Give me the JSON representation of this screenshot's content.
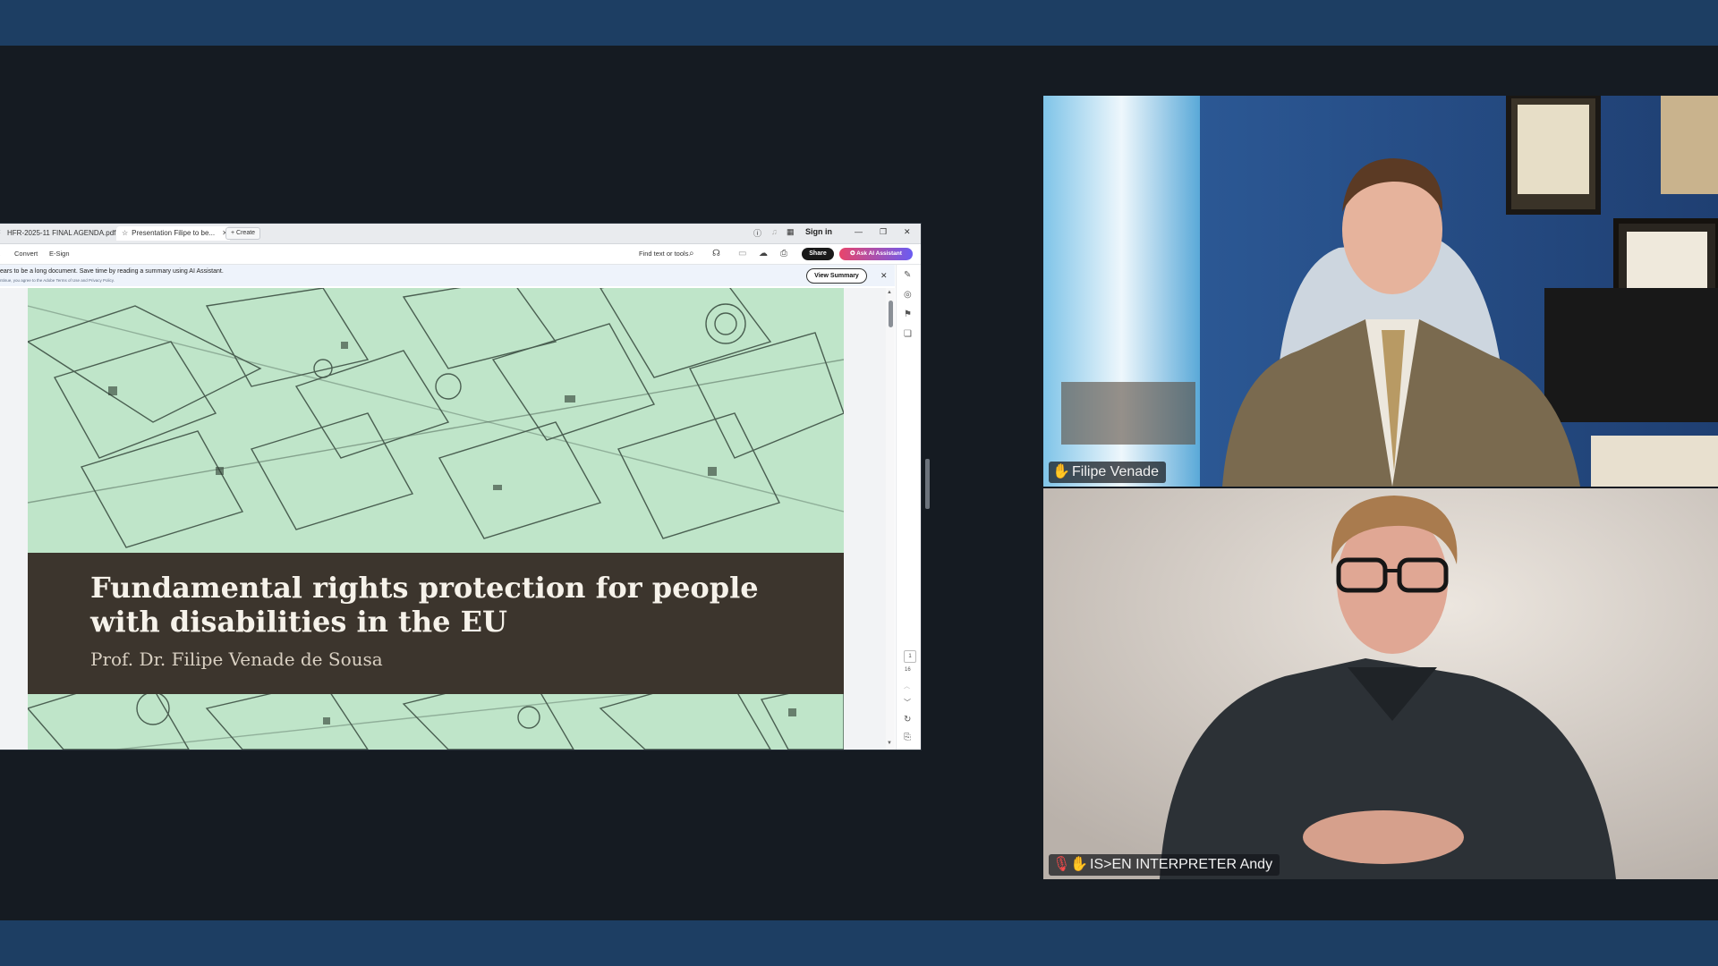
{
  "browser": {
    "tabs": [
      {
        "label": "HFR-2025-11 FINAL AGENDA.pdf"
      },
      {
        "label": "Presentation Filipe to be..."
      }
    ],
    "create_label": "Create",
    "sign_in": "Sign in"
  },
  "toolbar": {
    "items": [
      "Convert",
      "E-Sign"
    ],
    "find_label": "Find text or tools",
    "share_label": "Share",
    "ai_label": "Ask AI Assistant"
  },
  "notice": {
    "message": "ears to be a long document. Save time by reading a summary using AI Assistant.",
    "fine_print": "ntinue, you agree to the Adobe Terms of Use and Privacy Policy.",
    "view_summary": "View Summary"
  },
  "slide": {
    "title": "Fundamental rights protection for people with disabilities in the EU",
    "subtitle": "Prof. Dr. Filipe Venade de Sousa"
  },
  "page_nav": {
    "current": "1",
    "total": "16"
  },
  "participants": [
    {
      "name": "Filipe Venade",
      "muted": false
    },
    {
      "name": "IS>EN INTERPRETER Andy",
      "muted": true
    }
  ],
  "colors": {
    "band": "#1d3e63",
    "background": "#151b22",
    "slide_green": "#bfe5c9",
    "title_band": "#3c352d",
    "mute_red": "#ff4a4a"
  }
}
